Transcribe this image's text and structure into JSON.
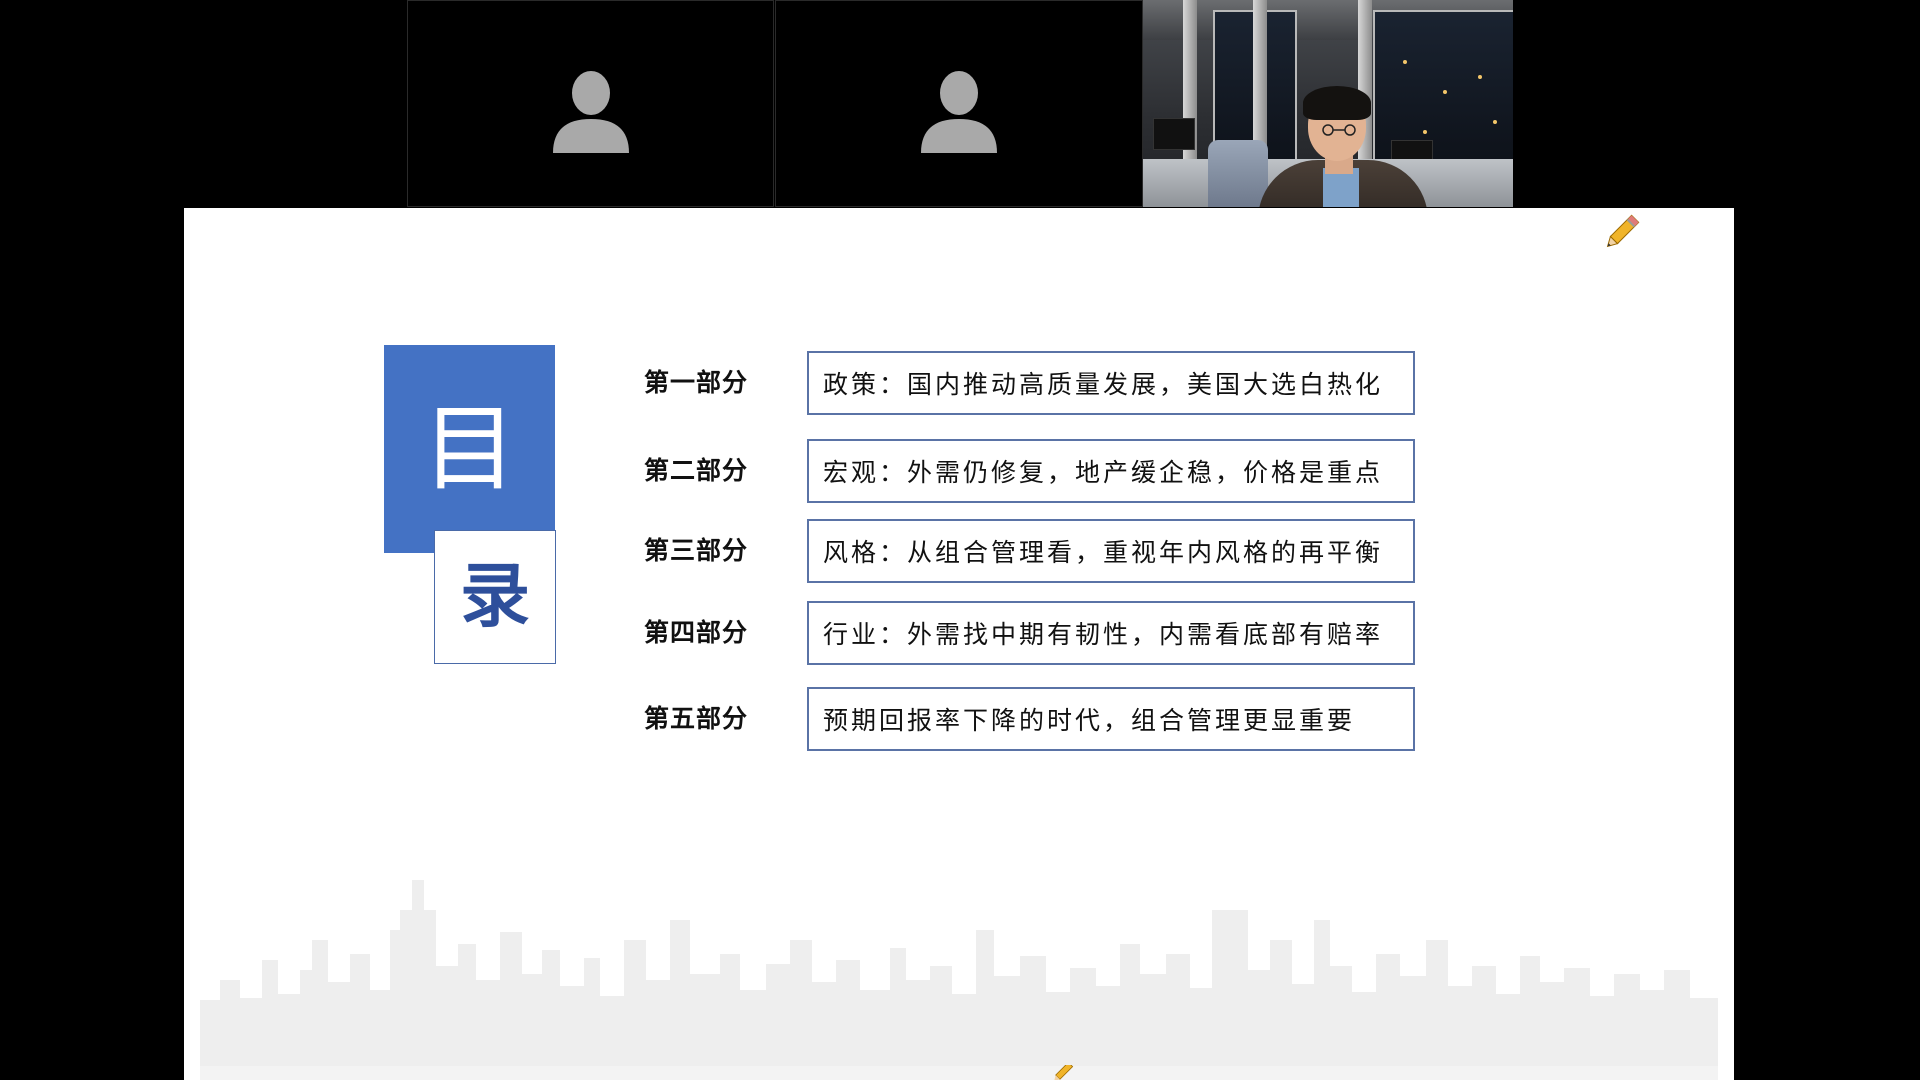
{
  "participants": {
    "tile_1": {
      "avatar_icon": "person-silhouette-icon"
    },
    "tile_2": {
      "avatar_icon": "person-silhouette-icon"
    },
    "tile_3": {
      "type": "camera-feed"
    }
  },
  "slide": {
    "title_char_1": "目",
    "title_char_2": "录",
    "accent_color": "#4472c4",
    "icons": [
      "pencil-icon"
    ],
    "toc": [
      {
        "label": "第一部分",
        "text": "政策：国内推动高质量发展，美国大选白热化"
      },
      {
        "label": "第二部分",
        "text": "宏观：外需仍修复，地产缓企稳，价格是重点"
      },
      {
        "label": "第三部分",
        "text": "风格：从组合管理看，重视年内风格的再平衡"
      },
      {
        "label": "第四部分",
        "text": "行业：外需找中期有韧性，内需看底部有赔率"
      },
      {
        "label": "第五部分",
        "text": "预期回报率下降的时代，组合管理更显重要"
      }
    ]
  }
}
